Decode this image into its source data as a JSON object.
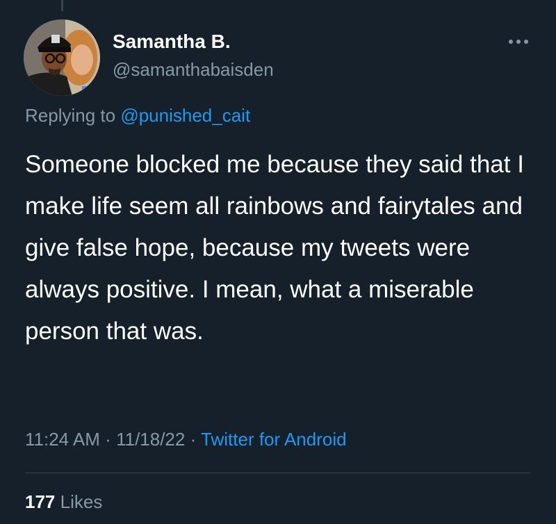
{
  "tweet": {
    "author": {
      "display_name": "Samantha B.",
      "handle": "@samanthabaisden"
    },
    "more_icon": "more-horizontal-icon",
    "reply": {
      "prefix": "Replying to",
      "mention": "@punished_cait"
    },
    "text": "Someone blocked me because they said that I make life seem all rainbows and fairytales and give false hope, because my tweets were always positive. I mean, what a miserable person that was.",
    "meta": {
      "time": "11:24 AM",
      "separator1": "·",
      "date": "11/18/22",
      "separator2": "·",
      "source": "Twitter for Android"
    },
    "stats": {
      "likes_count": "177",
      "likes_label": "Likes"
    }
  },
  "colors": {
    "background": "#15202b",
    "text_primary": "#ffffff",
    "text_secondary": "#8899a6",
    "accent": "#1d9bf0",
    "divider": "#38444d"
  }
}
